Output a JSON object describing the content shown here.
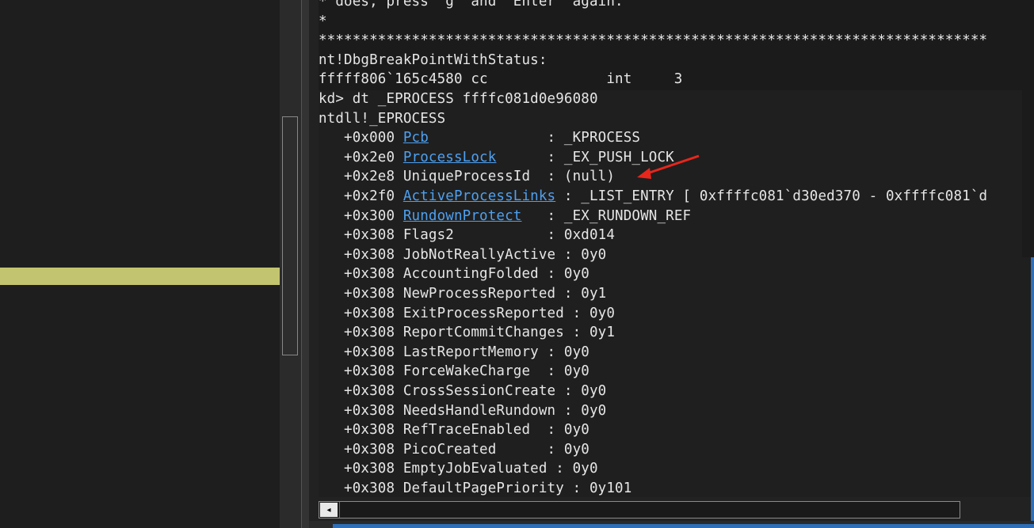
{
  "output": {
    "lines": [
      "* does, press \"g\" and \"Enter\" again.",
      "*",
      "*******************************************************************************",
      "nt!DbgBreakPointWithStatus:",
      "fffff806`165c4580 cc              int     3",
      "kd> dt _EPROCESS ffffc081d0e96080",
      "ntdll!_EPROCESS"
    ],
    "fields": [
      {
        "offset": "   +0x000 ",
        "name": "Pcb",
        "pad": "              ",
        "sep": ": ",
        "value": "_KPROCESS",
        "link": true
      },
      {
        "offset": "   +0x2e0 ",
        "name": "ProcessLock",
        "pad": "      ",
        "sep": ": ",
        "value": "_EX_PUSH_LOCK",
        "link": true
      },
      {
        "offset": "   +0x2e8 ",
        "name": "UniqueProcessId",
        "pad": "  ",
        "sep": ": ",
        "value": "(null)",
        "link": false
      },
      {
        "offset": "   +0x2f0 ",
        "name": "ActiveProcessLinks",
        "pad": " ",
        "sep": ": ",
        "value": "_LIST_ENTRY [ 0xffffc081`d30ed370 - 0xffffc081`d",
        "link": true
      },
      {
        "offset": "   +0x300 ",
        "name": "RundownProtect",
        "pad": "   ",
        "sep": ": ",
        "value": "_EX_RUNDOWN_REF",
        "link": true
      },
      {
        "offset": "   +0x308 ",
        "name": "Flags2",
        "pad": "           ",
        "sep": ": ",
        "value": "0xd014",
        "link": false
      },
      {
        "offset": "   +0x308 ",
        "name": "JobNotReallyActive",
        "pad": " ",
        "sep": ": ",
        "value": "0y0",
        "link": false
      },
      {
        "offset": "   +0x308 ",
        "name": "AccountingFolded",
        "pad": " ",
        "sep": ": ",
        "value": "0y0",
        "link": false
      },
      {
        "offset": "   +0x308 ",
        "name": "NewProcessReported",
        "pad": " ",
        "sep": ": ",
        "value": "0y1",
        "link": false
      },
      {
        "offset": "   +0x308 ",
        "name": "ExitProcessReported",
        "pad": " ",
        "sep": ": ",
        "value": "0y0",
        "link": false
      },
      {
        "offset": "   +0x308 ",
        "name": "ReportCommitChanges",
        "pad": " ",
        "sep": ": ",
        "value": "0y1",
        "link": false
      },
      {
        "offset": "   +0x308 ",
        "name": "LastReportMemory",
        "pad": " ",
        "sep": ": ",
        "value": "0y0",
        "link": false
      },
      {
        "offset": "   +0x308 ",
        "name": "ForceWakeCharge",
        "pad": "  ",
        "sep": ": ",
        "value": "0y0",
        "link": false
      },
      {
        "offset": "   +0x308 ",
        "name": "CrossSessionCreate",
        "pad": " ",
        "sep": ": ",
        "value": "0y0",
        "link": false
      },
      {
        "offset": "   +0x308 ",
        "name": "NeedsHandleRundown",
        "pad": " ",
        "sep": ": ",
        "value": "0y0",
        "link": false
      },
      {
        "offset": "   +0x308 ",
        "name": "RefTraceEnabled",
        "pad": "  ",
        "sep": ": ",
        "value": "0y0",
        "link": false
      },
      {
        "offset": "   +0x308 ",
        "name": "PicoCreated",
        "pad": "      ",
        "sep": ": ",
        "value": "0y0",
        "link": false
      },
      {
        "offset": "   +0x308 ",
        "name": "EmptyJobEvaluated",
        "pad": " ",
        "sep": ": ",
        "value": "0y0",
        "link": false
      },
      {
        "offset": "   +0x308 ",
        "name": "DefaultPagePriority",
        "pad": " ",
        "sep": ": ",
        "value": "0y101",
        "link": false
      }
    ]
  },
  "annotation": {
    "color": "#e8261c",
    "icon": "arrow-icon"
  },
  "scrollbar": {
    "left_arrow": "◂"
  }
}
